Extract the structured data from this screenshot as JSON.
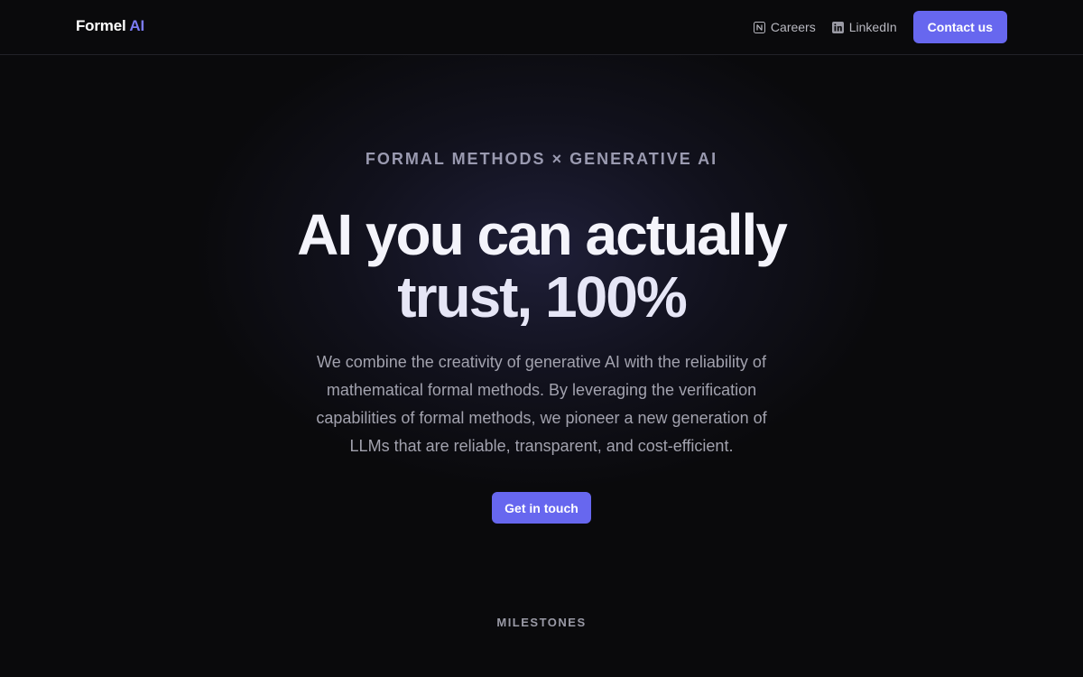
{
  "header": {
    "logo_main": "Formel",
    "logo_accent": "AI",
    "nav": [
      {
        "label": "Careers",
        "icon": "notion-icon"
      },
      {
        "label": "LinkedIn",
        "icon": "linkedin-icon"
      }
    ],
    "contact_label": "Contact us"
  },
  "hero": {
    "eyebrow": "FORMAL METHODS × GENERATIVE AI",
    "headline_line1": "AI you can actually",
    "headline_line2": "trust, 100%",
    "description": "We combine the creativity of generative AI with the reliability of mathematical formal methods. By leveraging the verification capabilities of formal methods, we pioneer a new generation of LLMs that are reliable, transparent, and cost-efficient.",
    "cta_label": "Get in touch"
  },
  "sections": {
    "milestones_title": "MILESTONES"
  },
  "colors": {
    "background": "#0a0a0c",
    "accent": "#6767ef",
    "logo_accent": "#7b7bf2",
    "muted_text": "#a2a2ae"
  }
}
